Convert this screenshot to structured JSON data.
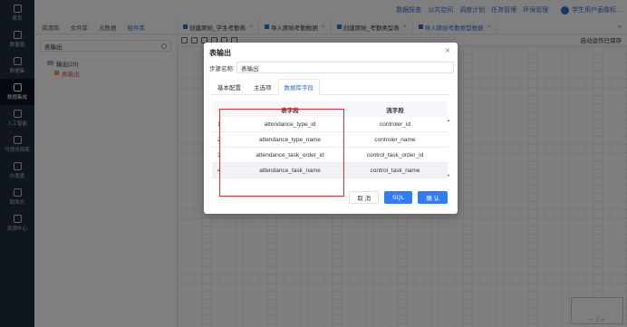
{
  "nav": {
    "items": [
      {
        "label": "首页",
        "icon": "home-icon"
      },
      {
        "label": "数据源",
        "icon": "database-icon"
      },
      {
        "label": "数据集",
        "icon": "dataset-icon"
      },
      {
        "label": "数据集成",
        "icon": "integration-icon"
      },
      {
        "label": "人工智能",
        "icon": "ai-icon"
      },
      {
        "label": "可视化探索",
        "icon": "explore-icon"
      },
      {
        "label": "仪表盘",
        "icon": "dashboard-icon"
      },
      {
        "label": "助驾仓",
        "icon": "cockpit-icon"
      },
      {
        "label": "资源中心",
        "icon": "resource-icon"
      }
    ]
  },
  "topbar": {
    "links": [
      "数据探查",
      "公共空间",
      "调度计划",
      "任务管理",
      "环境管理"
    ],
    "user": "学生用户画像标..."
  },
  "respanel": {
    "tabs": [
      "资源库",
      "文件库",
      "元数据",
      "组件库"
    ],
    "search_value": "表输出",
    "tree_folder": "输出(20)",
    "tree_leaf": "表输出"
  },
  "editor": {
    "tabs": [
      {
        "label": "创建原始_学生考勤表"
      },
      {
        "label": "导入原始考勤数据"
      },
      {
        "label": "创建原始_考勤类型表"
      },
      {
        "label": "导入原始考勤类型数据"
      }
    ],
    "more": "»",
    "autosave": "自动运作已保存",
    "minimap_label": "－ 1 ＋"
  },
  "dialog": {
    "title": "表输出",
    "close": "×",
    "step_label": "步骤名称:",
    "step_value": "表输出",
    "tabs": [
      "基本配置",
      "主选项",
      "数据库字段"
    ],
    "table": {
      "headers": [
        "",
        "表字段",
        "流字段"
      ],
      "rows": [
        {
          "idx": "1",
          "target": "attendance_type_id",
          "source": "controler_id"
        },
        {
          "idx": "2",
          "target": "attendance_type_name",
          "source": "controler_name"
        },
        {
          "idx": "3",
          "target": "attendance_task_order_id",
          "source": "control_task_order_id"
        },
        {
          "idx": "4",
          "target": "attendance_task_name",
          "source": "control_task_name"
        }
      ]
    },
    "buttons": {
      "cancel": "取 消",
      "sql": "SQL",
      "confirm": "确 认"
    }
  },
  "colors": {
    "nav_bg": "#1f2d3d",
    "accent": "#2f6fd6",
    "highlight": "#d9302c"
  }
}
